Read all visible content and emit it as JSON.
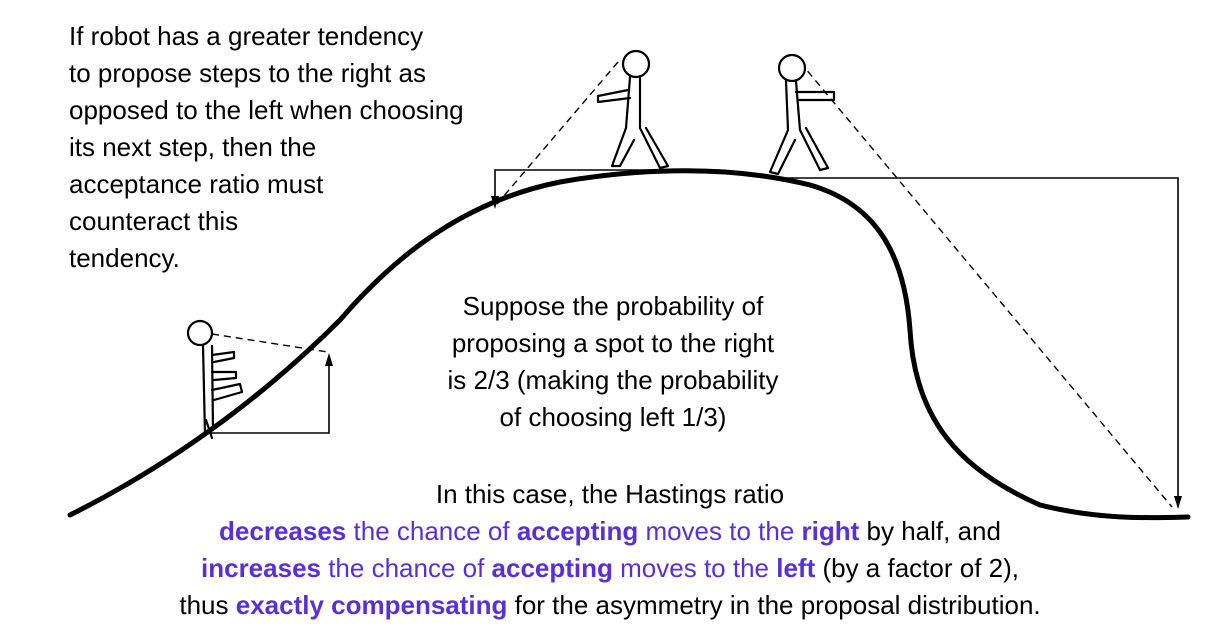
{
  "note_left": {
    "lines": [
      "If robot has a greater tendency",
      "to propose steps to the right as",
      "opposed to the left when choosing",
      "its next step, then the",
      "acceptance ratio must",
      "counteract this",
      "tendency."
    ]
  },
  "note_mid": {
    "lines": [
      "Suppose the probability of",
      "proposing a spot to the right",
      "is 2/3 (making the probability",
      "of choosing left 1/3)"
    ]
  },
  "summary": {
    "line1": "In this case, the Hastings ratio",
    "line2": {
      "w1": "decreases",
      "t1": " the chance of ",
      "w2": "accepting",
      "t2": " moves to the ",
      "w3": "right",
      "t3": " by half, and"
    },
    "line3": {
      "w1": "increases",
      "t1": " the chance of ",
      "w2": "accepting",
      "t2": " moves to the ",
      "w3": "left",
      "t3": " (by a factor of 2),"
    },
    "line4": {
      "t0": "thus ",
      "w1": "exactly compensating",
      "t1": " for the asymmetry in the proposal distribution."
    }
  },
  "colors": {
    "highlight": "#5a2fd8",
    "ink": "#000000"
  },
  "figures": [
    "robot-climbing",
    "robot-walking-left-at-peak",
    "robot-walking-right-at-peak"
  ]
}
